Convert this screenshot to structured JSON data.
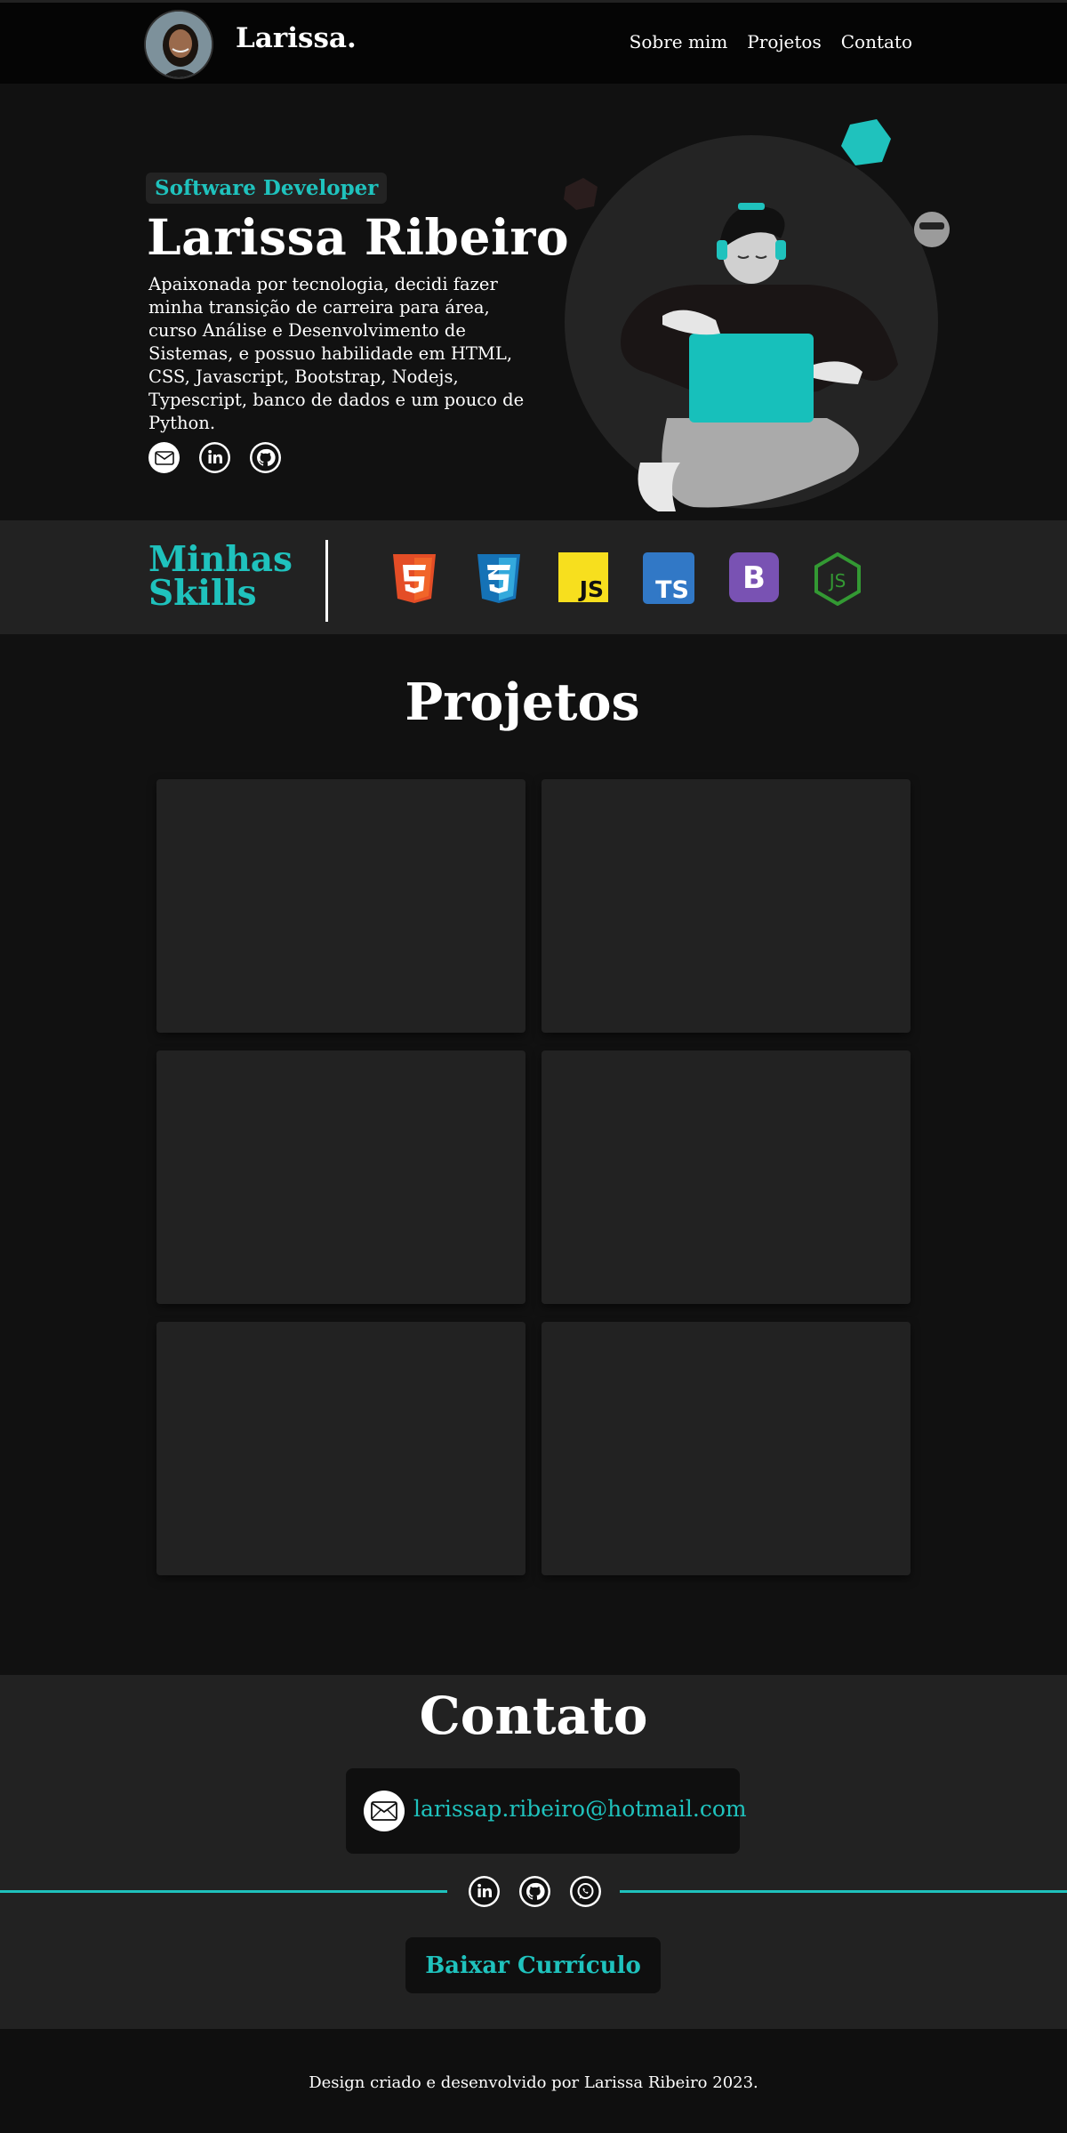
{
  "header": {
    "brand": "Larissa.",
    "nav": [
      "Sobre mim",
      "Projetos",
      "Contato"
    ]
  },
  "hero": {
    "role": "Software Developer",
    "name": "Larissa Ribeiro",
    "bio": "Apaixonada por tecnologia, decidi fazer minha transição de carreira para área, curso Análise e Desenvolvimento de Sistemas, e possuo habilidade em HTML, CSS, Javascript, Bootstrap, Nodejs, Typescript, banco de dados e um pouco de Python.",
    "social_icons": [
      "email-icon",
      "linkedin-icon",
      "github-icon"
    ]
  },
  "skills": {
    "title_line1": "Minhas",
    "title_line2": "Skills",
    "logos": [
      {
        "name": "html5",
        "label": "5",
        "color": "#e44d26"
      },
      {
        "name": "css3",
        "label": "3",
        "color": "#1572b6"
      },
      {
        "name": "javascript",
        "label": "JS",
        "color": "#f7df1e"
      },
      {
        "name": "typescript",
        "label": "TS",
        "color": "#3178c6"
      },
      {
        "name": "bootstrap",
        "label": "B",
        "color": "#7952b3"
      },
      {
        "name": "nodejs",
        "label": "JS",
        "color": "#339933"
      }
    ]
  },
  "projects": {
    "title": "Projetos",
    "cards": 6
  },
  "contact": {
    "title": "Contato",
    "email": "larissap.ribeiro@hotmail.com",
    "social_icons": [
      "linkedin-icon",
      "github-icon",
      "whatsapp-icon"
    ],
    "cv_button": "Baixar Currículo"
  },
  "footer": {
    "text": "Design criado e desenvolvido por Larissa Ribeiro 2023."
  },
  "colors": {
    "accent": "#1fc2bd",
    "background": "#111111",
    "panel": "#222222"
  }
}
